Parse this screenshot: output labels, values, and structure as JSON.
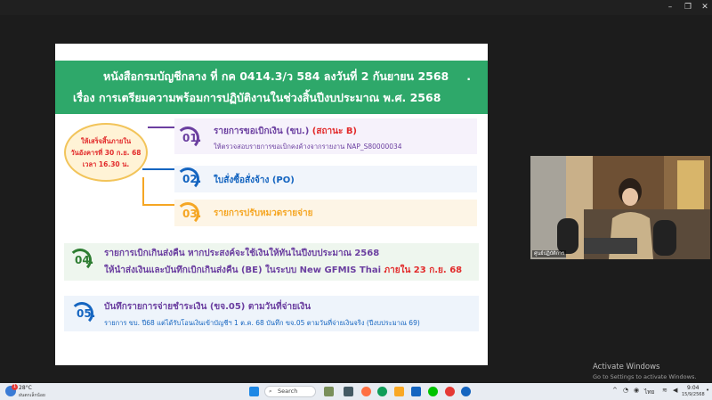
{
  "slide": {
    "header_line1": "หนังสือกรมบัญชีกลาง ที่ กค 0414.3/ว 584 ลงวันที่ 2 กันยายน 2568",
    "header_dot": ".",
    "header_line2": "เรื่อง การเตรียมความพร้อมการปฏิบัติงานในช่วงสิ้นปีงบประมาณ พ.ศ. 2568",
    "deadline": {
      "line1": "ให้เสร็จสิ้นภายใน",
      "line2": "วันอังคารที่ 30 ก.ย. 68",
      "line3": "เวลา 16.30 น."
    },
    "items": [
      {
        "num": "01.",
        "title": "รายการขอเบิกเงิน (ขบ.)",
        "title_red": "(สถานะ B)",
        "sub": "ให้ตรวจสอบรายการขอเบิกคงค้างจากรายงาน NAP_S80000034"
      },
      {
        "num": "02.",
        "title": "ใบสั่งซื้อสั่งจ้าง (PO)"
      },
      {
        "num": "03.",
        "title": "รายการปรับหมวดรายจ่าย"
      },
      {
        "num": "04.",
        "line1": "รายการเบิกเกินส่งคืน หากประสงค์จะใช้เงินให้ทันในปีงบประมาณ 2568",
        "line2": "ให้นำส่งเงินและบันทึกเบิกเกินส่งคืน (BE) ในระบบ New GFMIS Thai",
        "line2_red": "ภายใน 23 ก.ย. 68"
      },
      {
        "num": "05.",
        "line1": "บันทึกรายการจ่ายชำระเงิน (ขจ.05) ตามวันที่จ่ายเงิน",
        "line2": "รายการ ขบ. ปี68 แต่ได้รับโอนเงินเข้าบัญชีฯ 1 ต.ค. 68 บันทึก ขจ.05 ตามวันที่จ่ายเงินจริง (ปีงบประมาณ 69)"
      }
    ]
  },
  "camera": {
    "name": "ศูนย์ปฏิบัติการ"
  },
  "watermark": {
    "line1": "Activate Windows",
    "line2": "Go to Settings to activate Windows."
  },
  "taskbar": {
    "weather_temp": "28°C",
    "weather_desc": "ฝนตกเล็กน้อย",
    "search_placeholder": "Search",
    "lang": "ไทย",
    "time": "9:04",
    "date": "15/9/2568",
    "badge": "1"
  },
  "colors": {
    "green": "#2ea86a",
    "purple": "#6b3fa0",
    "blue": "#1565c0",
    "orange": "#f5a623",
    "red": "#e22b2b"
  }
}
